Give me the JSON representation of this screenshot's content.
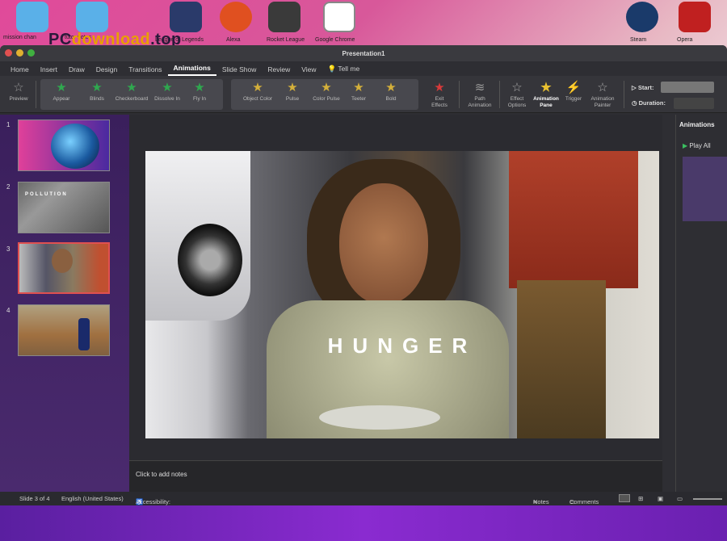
{
  "desktop": {
    "icons": [
      {
        "label": "mission chan",
        "color": "#5ab0e8"
      },
      {
        "label": "tutor notes",
        "color": "#5ab0e8"
      },
      {
        "label": "League of Legends",
        "color": "#2a3a6a"
      },
      {
        "label": "Alexa",
        "color": "#e05020"
      },
      {
        "label": "Rocket League",
        "color": "#3a3a3a"
      },
      {
        "label": "Google Chrome",
        "color": "#ffffff"
      },
      {
        "label": "Steam",
        "color": "#1a3a6a"
      },
      {
        "label": "Opera",
        "color": "#c02020"
      }
    ],
    "watermark_a": "PC",
    "watermark_b": "download",
    "watermark_c": ".top"
  },
  "window": {
    "title": "Presentation1",
    "tabs": [
      "Home",
      "Insert",
      "Draw",
      "Design",
      "Transitions",
      "Animations",
      "Slide Show",
      "Review",
      "View",
      "Tell me"
    ],
    "active_tab": "Animations"
  },
  "ribbon": {
    "preview": "Preview",
    "entrance_effects": [
      "Appear",
      "Blinds",
      "Checkerboard",
      "Dissolve In",
      "Fly In"
    ],
    "emphasis_effects": [
      "Object Color",
      "Pulse",
      "Color Pulse",
      "Teeter",
      "Bold"
    ],
    "exit_effects": "Exit Effects",
    "path_animation": "Path Animation",
    "effect_options": "Effect Options",
    "animation_pane": "Animation Pane",
    "trigger": "Trigger",
    "animation_painter": "Animation Painter",
    "start_label": "Start:",
    "duration_label": "Duration:",
    "entrance_color": "#2fa84f",
    "emphasis_color": "#d4b03a",
    "exit_color": "#d83a3a"
  },
  "slides": [
    {
      "number": "1",
      "theme": "earth"
    },
    {
      "number": "2",
      "theme": "pollution",
      "caption": "POLLUTION"
    },
    {
      "number": "3",
      "theme": "hunger",
      "selected": true
    },
    {
      "number": "4",
      "theme": "slum"
    }
  ],
  "current_slide": {
    "title": "HUNGER"
  },
  "notes_placeholder": "Click to add notes",
  "animations_pane": {
    "title": "Animations",
    "play_all": "Play All"
  },
  "status": {
    "slide_indicator": "Slide 3 of 4",
    "language": "English (United States)",
    "accessibility": "Accessibility: Investigate",
    "notes": "Notes",
    "comments": "Comments"
  }
}
